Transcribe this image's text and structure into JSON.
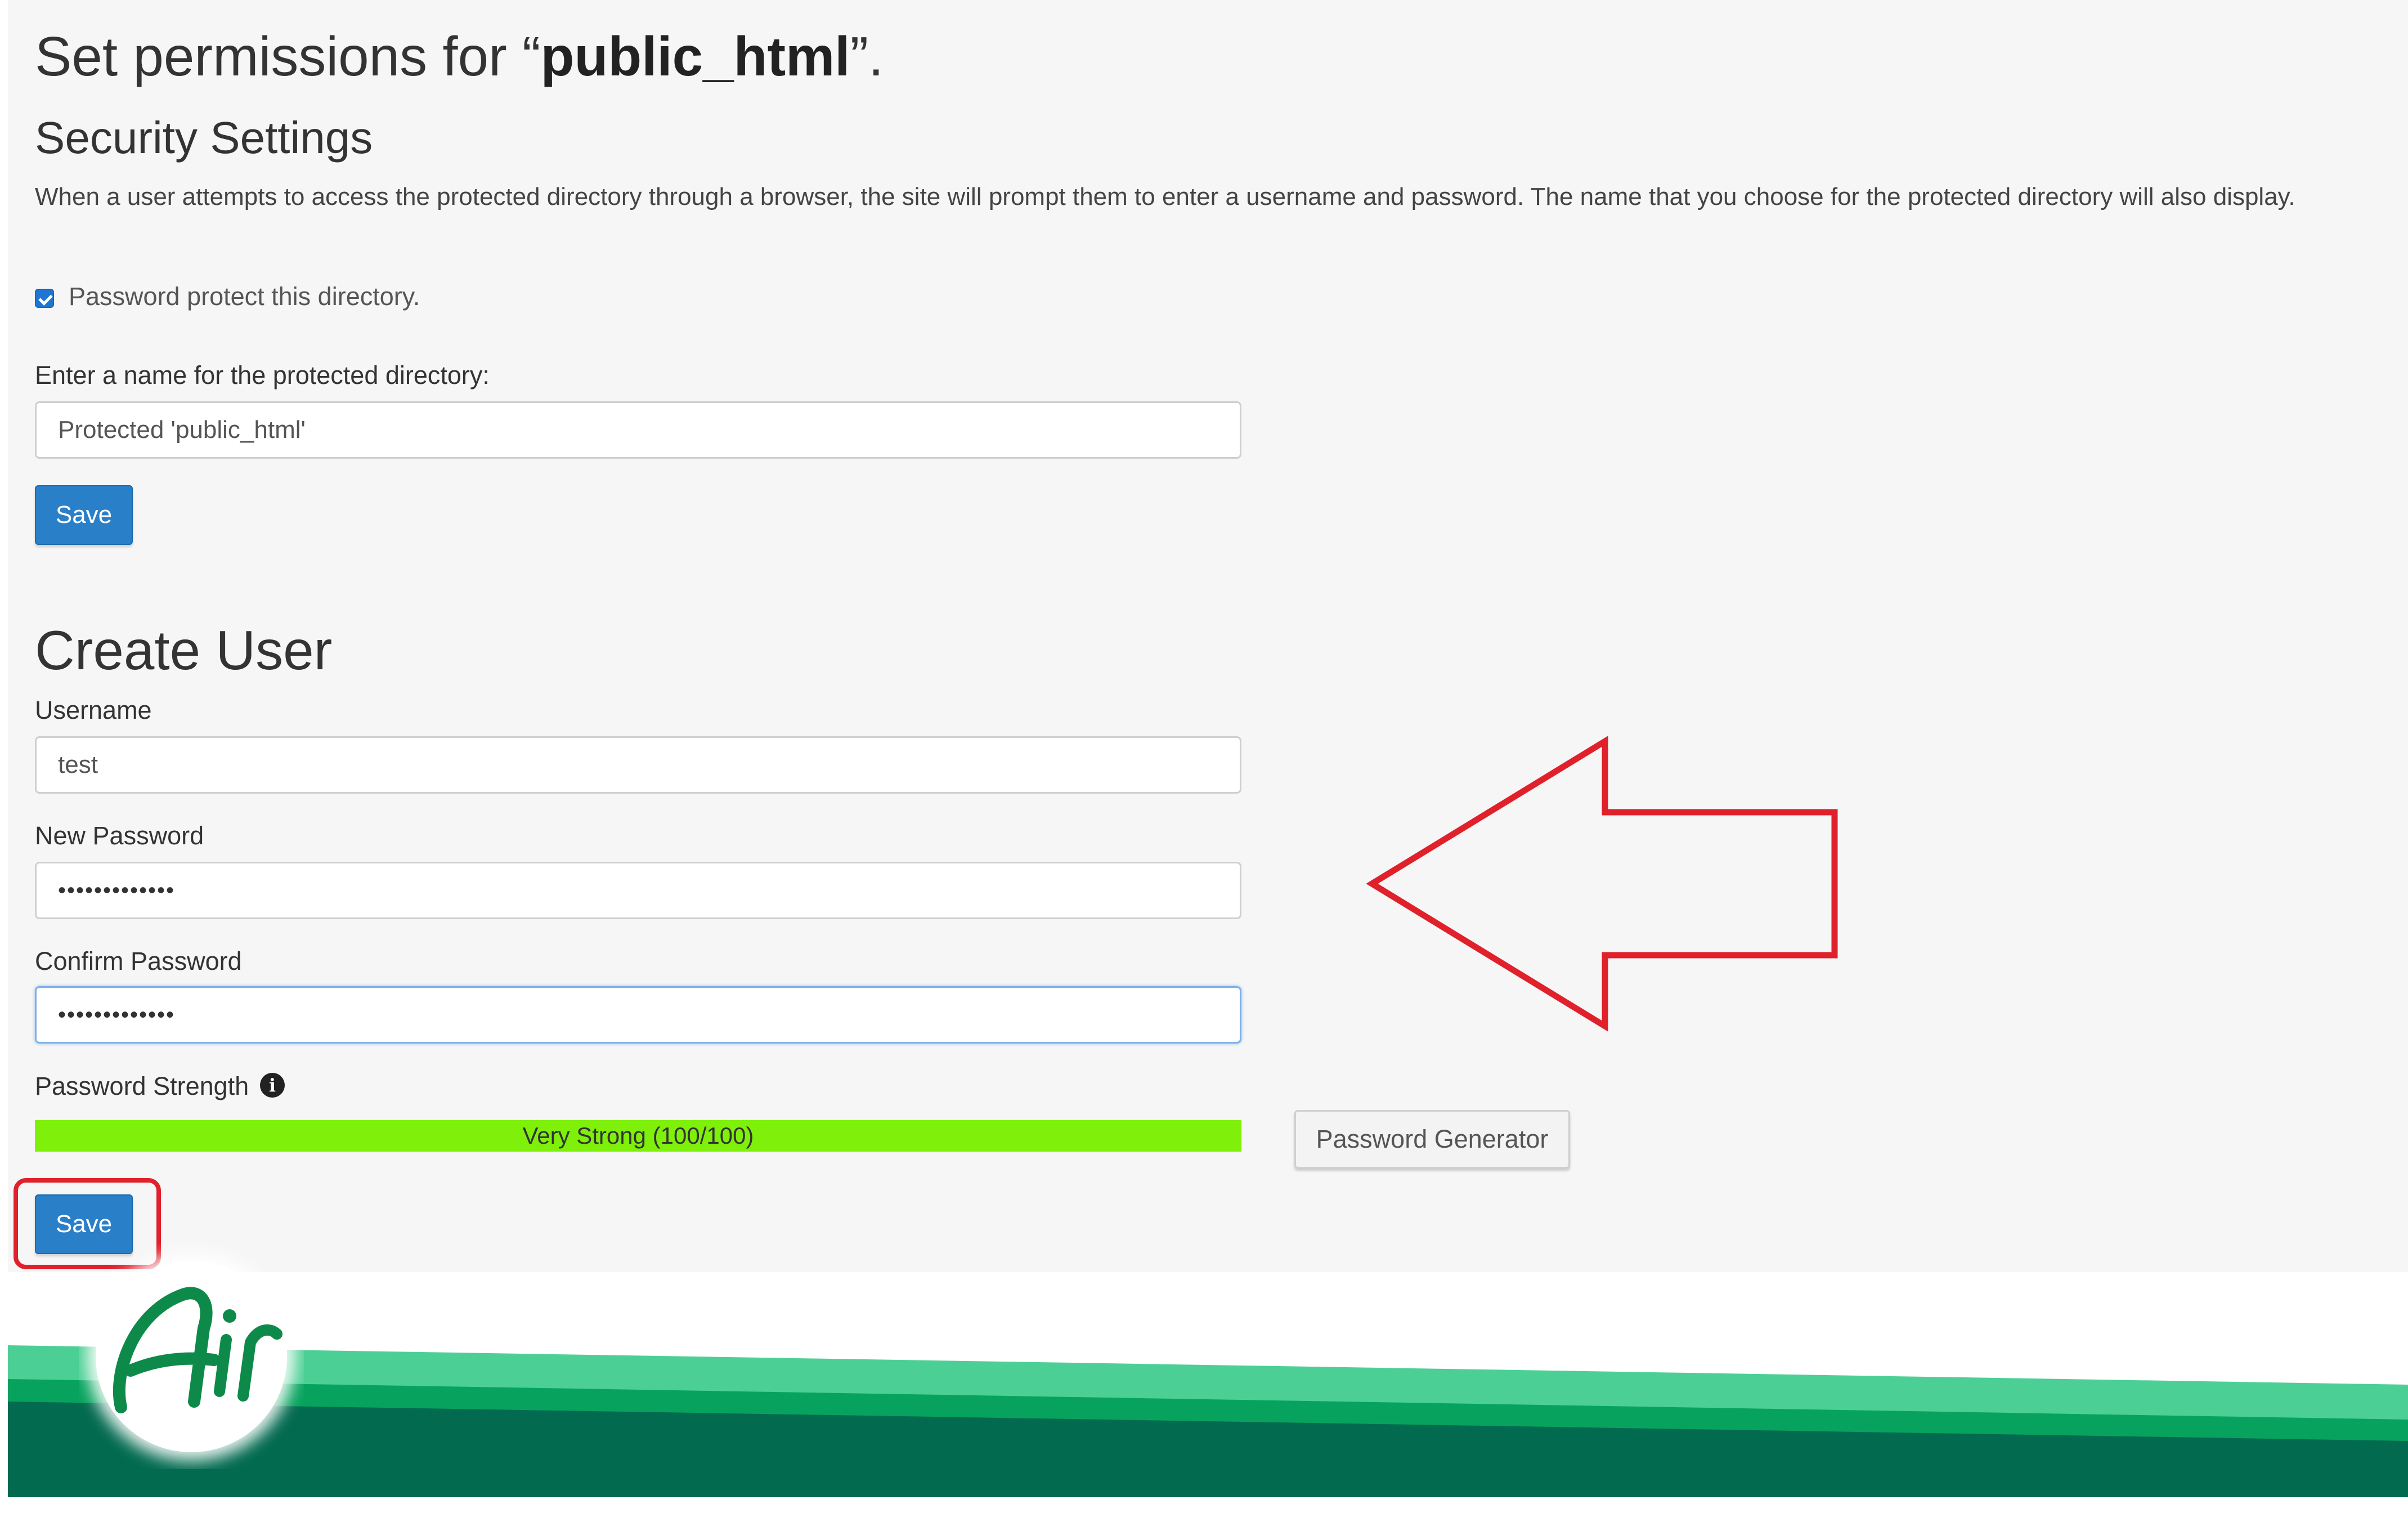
{
  "header": {
    "title_prefix": "Set permissions for “",
    "title_dir": "public_html",
    "title_suffix": "”."
  },
  "security": {
    "heading": "Security Settings",
    "description": "When a user attempts to access the protected directory through a browser, the site will prompt them to enter a username and password. The name that you choose for the protected directory will also display.",
    "protect_checked": true,
    "protect_label": "Password protect this directory.",
    "dir_name_label": "Enter a name for the protected directory:",
    "dir_name_value": "Protected 'public_html'",
    "save_label": "Save"
  },
  "create_user": {
    "heading": "Create User",
    "username_label": "Username",
    "username_value": "test",
    "new_password_label": "New Password",
    "new_password_value": "•••••••••••••",
    "confirm_password_label": "Confirm Password",
    "confirm_password_value": "•••••••••••••",
    "strength_label": "Password Strength",
    "strength_text": "Very Strong (100/100)",
    "strength_fraction": 1.0,
    "strength_color": "#7ff00a",
    "password_generator_label": "Password Generator",
    "save_label": "Save"
  },
  "annotations": {
    "arrow_color": "#e0202a",
    "highlight_color": "#e0202a"
  },
  "brand": {
    "logo_text": "Air",
    "logo_color": "#0d8a4a",
    "banner_colors": [
      "#4ccf95",
      "#07a35e",
      "#026a4f"
    ]
  },
  "icons": {
    "info": "info-icon",
    "checkbox": "checkbox-checked-icon",
    "arrow": "arrow-left-icon"
  }
}
